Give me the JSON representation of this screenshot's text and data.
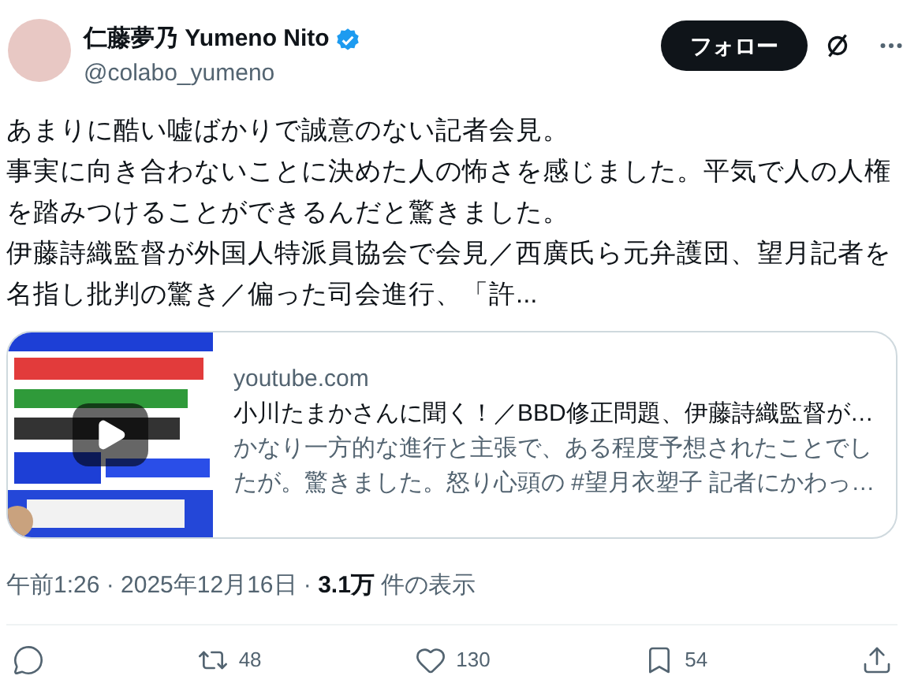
{
  "author": {
    "name": "仁藤夢乃 Yumeno Nito",
    "verified": true,
    "handle": "@colabo_yumeno"
  },
  "follow_button": "フォロー",
  "body": [
    "あまりに酷い嘘ばかりで誠意のない記者会見。",
    "事実に向き合わないことに決めた人の怖さを感じました。平気で人の人権を踏みつけることができるんだと驚きました。",
    "伊藤詩織監督が外国人特派員協会で会見／西廣氏ら元弁護団、望月記者を名指し批判の驚き／偏った司会進行、「許..."
  ],
  "link_card": {
    "domain": "youtube.com",
    "title": "小川たまかさんに聞く！／BBD修正問題、伊藤詩織監督が…",
    "description": "かなり一方的な進行と主張で、ある程度予想されたことでしたが。驚きました。怒り心頭の #望月衣塑子 記者にかわっ…"
  },
  "meta": {
    "time": "午前1:26 · 2025年12月16日 · ",
    "views": "3.1万",
    "views_label": " 件の表示"
  },
  "actions": [
    {
      "kind": "reply"
    },
    {
      "kind": "repost",
      "count": "48"
    },
    {
      "kind": "like",
      "count": "130"
    },
    {
      "kind": "bookmark",
      "count": "54"
    },
    {
      "kind": "share"
    }
  ]
}
